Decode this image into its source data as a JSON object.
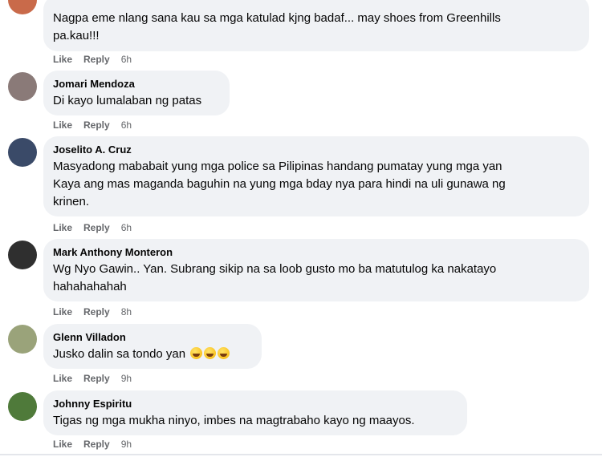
{
  "comments": [
    {
      "author": "",
      "text": "Nagpa eme nlang sana kau sa mga katulad kjng badaf... may shoes from Greenhills\npa.kau!!!",
      "like": "Like",
      "reply": "Reply",
      "time": "6h",
      "avatar_color": "#c96a4a"
    },
    {
      "author": "Jomari Mendoza",
      "text": "Di kayo lumalaban ng patas",
      "like": "Like",
      "reply": "Reply",
      "time": "6h",
      "avatar_color": "#8a7a78"
    },
    {
      "author": "Joselito A. Cruz",
      "text": "Masyadong mababait yung mga police sa Pilipinas handang pumatay yung mga yan\nKaya ang mas maganda baguhin na yung mga bday nya para hindi na uli gunawa ng\nkrinen.",
      "like": "Like",
      "reply": "Reply",
      "time": "6h",
      "avatar_color": "#3a4a68"
    },
    {
      "author": "Mark Anthony Monteron",
      "text": "Wg Nyo Gawin.. Yan. Subrang sikip na sa loob gusto mo ba matutulog ka nakatayo\nhahahahahah",
      "like": "Like",
      "reply": "Reply",
      "time": "8h",
      "avatar_color": "#2f2f2f"
    },
    {
      "author": "Glenn Villadon",
      "text": "Jusko dalin sa tondo yan",
      "like": "Like",
      "reply": "Reply",
      "time": "9h",
      "avatar_color": "#9aa37a"
    },
    {
      "author": "Johnny Espiritu",
      "text": "Tigas ng mga mukha ninyo, imbes na magtrabaho kayo ng maayos.",
      "like": "Like",
      "reply": "Reply",
      "time": "9h",
      "avatar_color": "#4f7a3a"
    }
  ]
}
